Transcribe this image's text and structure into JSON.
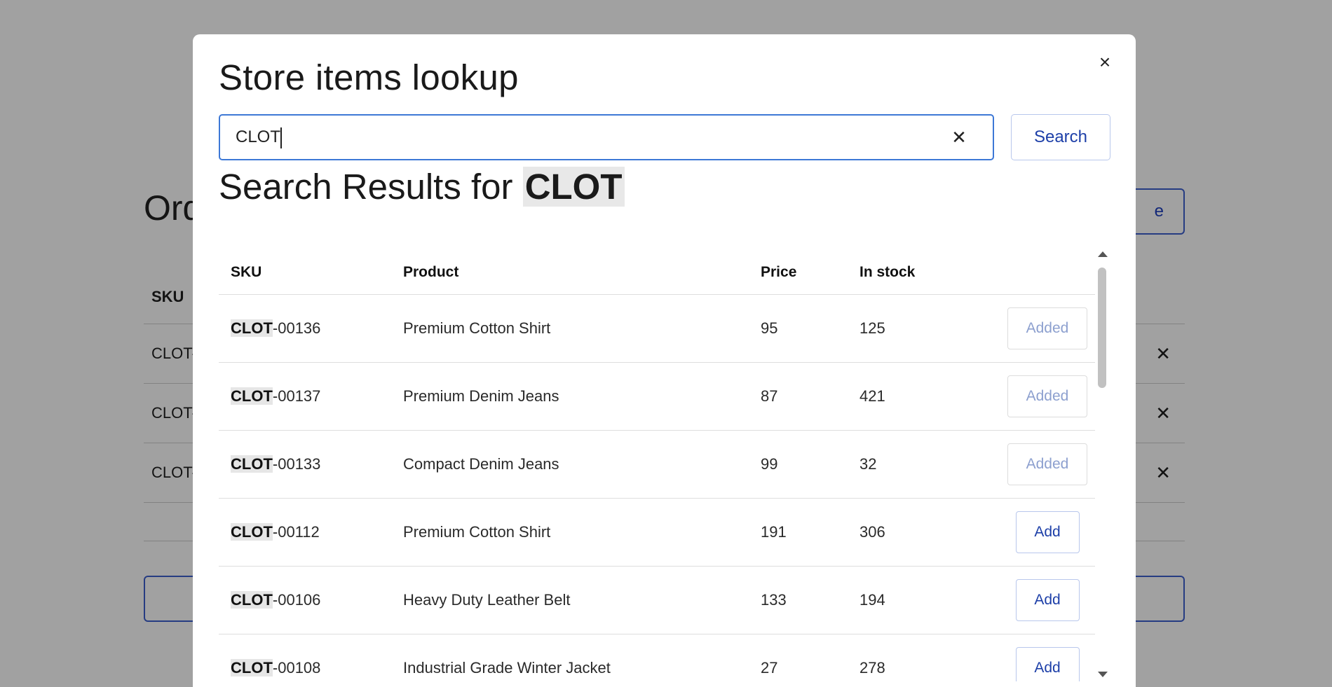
{
  "background": {
    "title_partial": "Ord",
    "outline_button_partial": "e",
    "table_header_sku": "SKU",
    "rows": [
      {
        "sku_partial": "CLOT-",
        "action": "✕"
      },
      {
        "sku_partial": "CLOT-",
        "action": "✕"
      },
      {
        "sku_partial": "CLOT-",
        "action": "✕"
      }
    ]
  },
  "modal": {
    "title": "Store items lookup",
    "close_icon": "×",
    "search": {
      "value": "CLOT",
      "clear_icon": "✕",
      "button_label": "Search"
    },
    "results_heading_prefix": "Search Results for",
    "results_query": "CLOT",
    "table": {
      "headers": {
        "sku": "SKU",
        "product": "Product",
        "price": "Price",
        "stock": "In stock"
      },
      "rows": [
        {
          "sku_prefix": "CLOT",
          "sku_suffix": "-00136",
          "product": "Premium Cotton Shirt",
          "price": "95",
          "stock": "125",
          "action": "Added",
          "added": true
        },
        {
          "sku_prefix": "CLOT",
          "sku_suffix": "-00137",
          "product": "Premium Denim Jeans",
          "price": "87",
          "stock": "421",
          "action": "Added",
          "added": true
        },
        {
          "sku_prefix": "CLOT",
          "sku_suffix": "-00133",
          "product": "Compact Denim Jeans",
          "price": "99",
          "stock": "32",
          "action": "Added",
          "added": true
        },
        {
          "sku_prefix": "CLOT",
          "sku_suffix": "-00112",
          "product": "Premium Cotton Shirt",
          "price": "191",
          "stock": "306",
          "action": "Add",
          "added": false
        },
        {
          "sku_prefix": "CLOT",
          "sku_suffix": "-00106",
          "product": "Heavy Duty Leather Belt",
          "price": "133",
          "stock": "194",
          "action": "Add",
          "added": false
        },
        {
          "sku_prefix": "CLOT",
          "sku_suffix": "-00108",
          "product": "Industrial Grade Winter Jacket",
          "price": "27",
          "stock": "278",
          "action": "Add",
          "added": false
        }
      ]
    }
  },
  "colors": {
    "accent": "#1d3fa8",
    "focus_border": "#3d78d6",
    "overlay": "rgba(0,0,0,0.37)"
  }
}
